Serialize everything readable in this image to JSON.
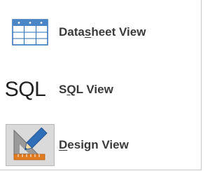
{
  "menu": {
    "items": [
      {
        "label_pre": "Data",
        "label_key": "s",
        "label_post": "heet View",
        "icon": "datasheet-grid-icon",
        "selected": false
      },
      {
        "label_pre": "S",
        "label_key": "Q",
        "label_post": "L View",
        "icon": "sql-text-icon",
        "icon_text": "SQL",
        "selected": false
      },
      {
        "label_pre": "",
        "label_key": "D",
        "label_post": "esign View",
        "icon": "design-ruler-pencil-icon",
        "selected": true
      }
    ]
  },
  "colors": {
    "grid_blue": "#2b6fb5",
    "grid_header": "#4a86c5",
    "selected_bg": "#dadada",
    "ruler_orange": "#e07b20",
    "pencil_blue": "#2f6db7"
  }
}
